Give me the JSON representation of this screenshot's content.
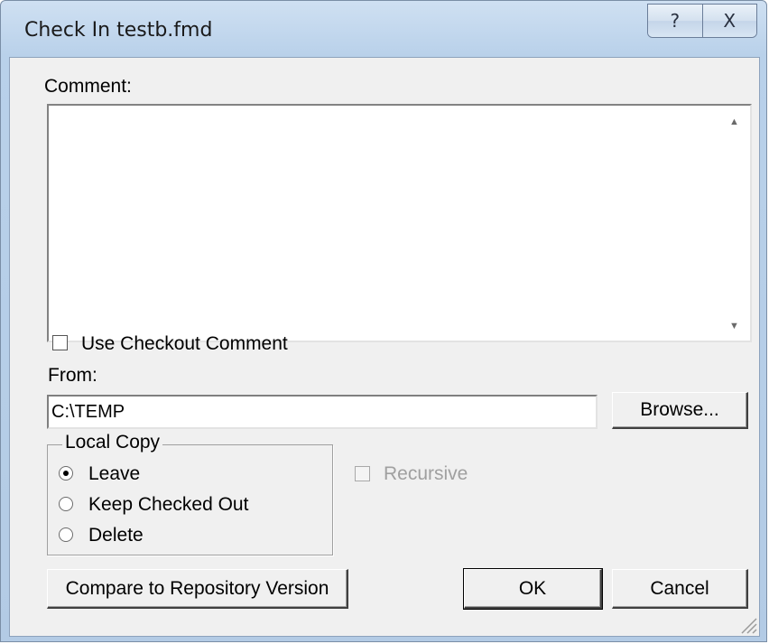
{
  "window": {
    "title": "Check In testb.fmd",
    "help_glyph": "?",
    "close_glyph": "X"
  },
  "comment": {
    "label": "Comment:",
    "value": ""
  },
  "use_checkout_comment": {
    "label": "Use Checkout Comment",
    "checked": false
  },
  "from": {
    "label": "From:",
    "value": "C:\\TEMP",
    "browse_label": "Browse..."
  },
  "local_copy": {
    "legend": "Local Copy",
    "options": [
      "Leave",
      "Keep Checked Out",
      "Delete"
    ],
    "selected": "Leave"
  },
  "recursive": {
    "label": "Recursive",
    "checked": false,
    "enabled": false
  },
  "buttons": {
    "compare": "Compare to Repository Version",
    "ok": "OK",
    "cancel": "Cancel"
  }
}
